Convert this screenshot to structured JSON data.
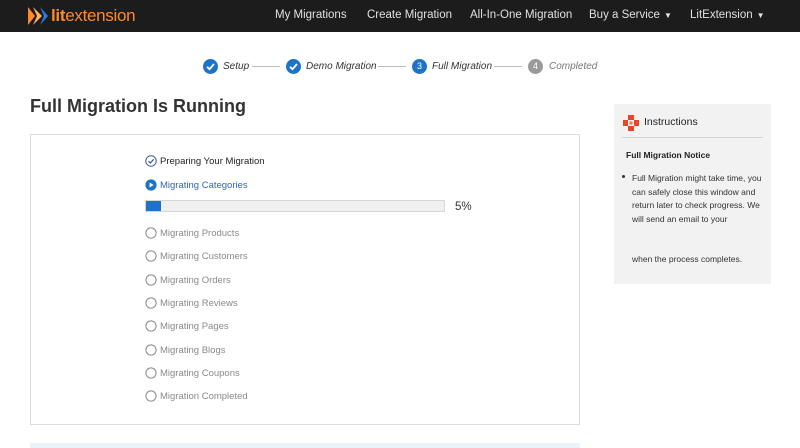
{
  "brand": {
    "name_part1": "lit",
    "name_part2": "extension"
  },
  "nav": {
    "items": [
      {
        "label": "My Migrations",
        "dropdown": false
      },
      {
        "label": "Create Migration",
        "dropdown": false
      },
      {
        "label": "All-In-One Migration",
        "dropdown": false
      },
      {
        "label": "Buy a Service",
        "dropdown": true
      },
      {
        "label": "LitExtension",
        "dropdown": true
      }
    ]
  },
  "stepper": {
    "steps": [
      {
        "label": "Setup",
        "state": "done",
        "number": ""
      },
      {
        "label": "Demo Migration",
        "state": "done",
        "number": ""
      },
      {
        "label": "Full Migration",
        "state": "current",
        "number": "3"
      },
      {
        "label": "Completed",
        "state": "pending",
        "number": "4"
      }
    ]
  },
  "page": {
    "title": "Full Migration Is Running"
  },
  "tasks": [
    {
      "label": "Preparing Your Migration",
      "state": "done"
    },
    {
      "label": "Migrating Categories",
      "state": "active"
    },
    {
      "label": "Migrating Products",
      "state": "pending"
    },
    {
      "label": "Migrating Customers",
      "state": "pending"
    },
    {
      "label": "Migrating Orders",
      "state": "pending"
    },
    {
      "label": "Migrating Reviews",
      "state": "pending"
    },
    {
      "label": "Migrating Pages",
      "state": "pending"
    },
    {
      "label": "Migrating Blogs",
      "state": "pending"
    },
    {
      "label": "Migrating Coupons",
      "state": "pending"
    },
    {
      "label": "Migration Completed",
      "state": "pending"
    }
  ],
  "progress": {
    "percent": 5,
    "label": "5%"
  },
  "instructions": {
    "title": "Instructions",
    "subtitle": "Full Migration Notice",
    "body": "Full Migration might take time, you can safely close this window and return later to check progress. We will send an email to your",
    "tail": "when the process completes."
  },
  "colors": {
    "accent": "#1f73c7",
    "brand": "#ff8a2a",
    "nav_bg": "#1c1c1c",
    "active_task": "#3465b8"
  }
}
